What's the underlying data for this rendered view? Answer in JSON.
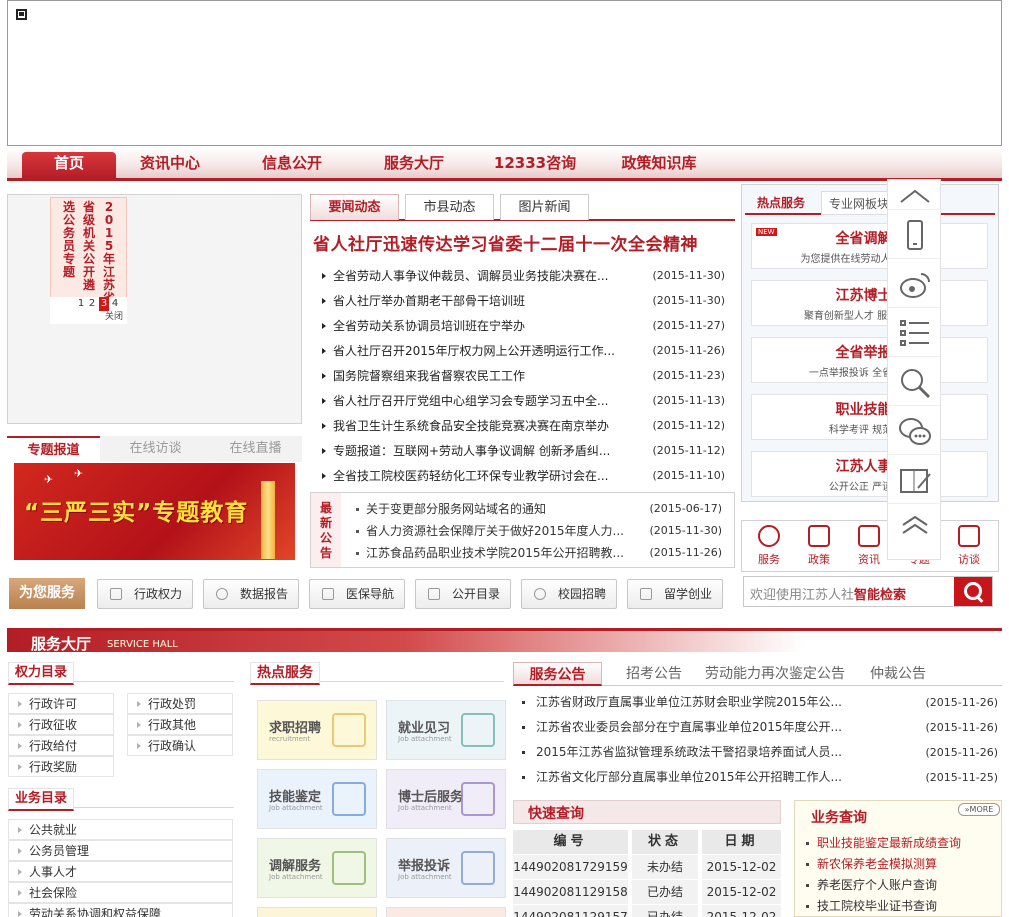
{
  "nav": [
    "首页",
    "资讯中心",
    "信息公开",
    "服务大厅",
    "12333咨询",
    "政策知识库"
  ],
  "vcard": {
    "cols": [
      "2015年江苏省",
      "省级机关公开遴",
      "选公务员专题"
    ],
    "pages": [
      "1",
      "2",
      "3",
      "4"
    ],
    "active_page": "3",
    "close": "关闭"
  },
  "special_tabs": [
    "专题报道",
    "在线访谈",
    "在线直播"
  ],
  "promo": {
    "text": "“三严三实”专题教育"
  },
  "news_tabs": [
    "要闻动态",
    "市县动态",
    "图片新闻"
  ],
  "headline": "省人社厅迅速传达学习省委十二届十一次全会精神",
  "news": [
    {
      "title": "全省劳动人事争议仲裁员、调解员业务技能决赛在...",
      "date": "(2015-11-30)"
    },
    {
      "title": "省人社厅举办首期老干部骨干培训班",
      "date": "(2015-11-30)"
    },
    {
      "title": "全省劳动关系协调员培训班在宁举办",
      "date": "(2015-11-27)"
    },
    {
      "title": "省人社厅召开2015年厅权力网上公开透明运行工作...",
      "date": "(2015-11-26)"
    },
    {
      "title": "国务院督察组来我省督察农民工工作",
      "date": "(2015-11-23)"
    },
    {
      "title": "省人社厅召开厅党组中心组学习会专题学习五中全...",
      "date": "(2015-11-13)"
    },
    {
      "title": "我省卫生计生系统食品安全技能竞赛决赛在南京举办",
      "date": "(2015-11-12)"
    },
    {
      "title": "专题报道：互联网+劳动人事争议调解 创新矛盾纠...",
      "date": "(2015-11-12)"
    },
    {
      "title": "全省技工院校医药轻纺化工环保专业教学研讨会在...",
      "date": "(2015-11-10)"
    }
  ],
  "notice": {
    "label": "最新公告",
    "items": [
      {
        "title": "关于变更部分服务网站域名的通知",
        "date": "(2015-06-17)"
      },
      {
        "title": "省人力资源社会保障厅关于做好2015年度人力...",
        "date": "(2015-11-30)"
      },
      {
        "title": "江苏食品药品职业技术学院2015年公开招聘教...",
        "date": "(2015-11-26)"
      }
    ]
  },
  "hot": {
    "tabs": [
      "热点服务",
      "专业网板块"
    ],
    "badge": "NEW",
    "items": [
      {
        "title": "全省调解服",
        "sub": "为您提供在线劳动人事争议服务"
      },
      {
        "title": "江苏博士后",
        "sub": "聚育创新型人才 服务创新企业"
      },
      {
        "title": "全省举报投",
        "sub": "一点举报投诉 全省联动处理"
      },
      {
        "title": "职业技能鉴",
        "sub": "科学考评 规范鉴定"
      },
      {
        "title": "江苏人事考",
        "sub": "公开公正 严谨求实"
      }
    ]
  },
  "icon_links": [
    "服务",
    "政策",
    "资讯",
    "专题",
    "访谈"
  ],
  "search": {
    "placeholder": "欢迎使用江苏人社",
    "highlight": "智能检索"
  },
  "for_you": "为您服务",
  "quick_buttons": [
    "行政权力",
    "数据报告",
    "医保导航",
    "公开目录",
    "校园招聘",
    "留学创业"
  ],
  "hall": {
    "title": "服务大厅",
    "english": "SERVICE HALL"
  },
  "power_title": "权力目录",
  "power_items": [
    "行政许可",
    "行政处罚",
    "行政征收",
    "行政其他",
    "行政给付",
    "行政确认",
    "行政奖励"
  ],
  "biz_title": "业务目录",
  "biz_items": [
    "公共就业",
    "公务员管理",
    "人事人才",
    "社会保险",
    "劳动关系协调和权益保障"
  ],
  "hot_service_title": "热点服务",
  "tiles": [
    {
      "title": "求职招聘",
      "sub": "recruitment",
      "color": "#fdf9d8"
    },
    {
      "title": "就业见习",
      "sub": "Job attachment",
      "color": "#ecf4f8"
    },
    {
      "title": "技能鉴定",
      "sub": "Job attachment",
      "color": "#eaf2fb"
    },
    {
      "title": "博士后服务",
      "sub": "Job attachment",
      "color": "#f0ecf8"
    },
    {
      "title": "调解服务",
      "sub": "Job attachment",
      "color": "#f1f7e6"
    },
    {
      "title": "举报投诉",
      "sub": "Job attachment",
      "color": "#ecf0f8"
    }
  ],
  "announce_tabs": [
    "服务公告",
    "招考公告",
    "劳动能力再次鉴定公告",
    "仲裁公告"
  ],
  "announcements": [
    {
      "title": "江苏省财政厅直属事业单位江苏财会职业学院2015年公...",
      "date": "(2015-11-26)"
    },
    {
      "title": "江苏省农业委员会部分在宁直属事业单位2015年度公开...",
      "date": "(2015-11-26)"
    },
    {
      "title": "2015年江苏省监狱管理系统政法干警招录培养面试人员...",
      "date": "(2015-11-26)"
    },
    {
      "title": "江苏省文化厅部分直属事业单位2015年公开招聘工作人...",
      "date": "(2015-11-25)"
    }
  ],
  "quick_query": {
    "title": "快速查询",
    "headers": [
      "编号",
      "状态",
      "日期"
    ],
    "rows": [
      [
        "144902081729159",
        "未办结",
        "2015-12-02"
      ],
      [
        "144902081129158",
        "已办结",
        "2015-12-02"
      ],
      [
        "144902081129157",
        "已办结",
        "2015-12-02"
      ]
    ]
  },
  "biz_query": {
    "title": "业务查询",
    "more": "MORE",
    "items": [
      "职业技能鉴定最新成绩查询",
      "新农保养老金模拟测算",
      "养老医疗个人账户查询",
      "技工院校毕业证书查询"
    ]
  }
}
